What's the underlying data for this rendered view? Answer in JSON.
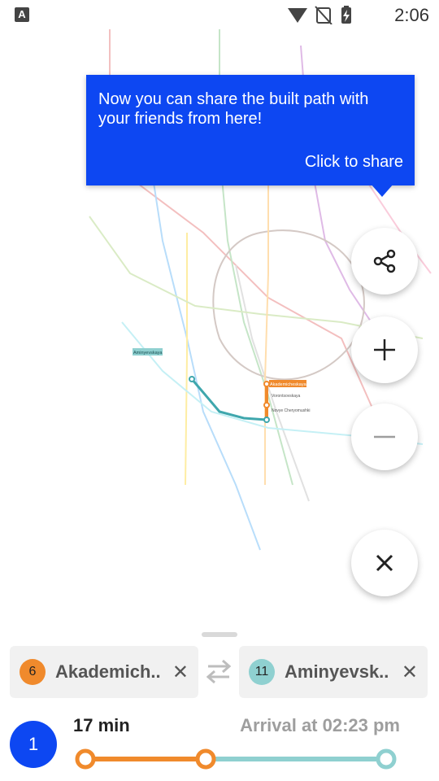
{
  "status_bar": {
    "app_icon_letter": "A",
    "time": "2:06"
  },
  "tooltip": {
    "message": "Now you can share the built path with your friends from here!",
    "action": "Click to share"
  },
  "map": {
    "labels": {
      "highlight_station": "Aminyevskaya",
      "route_station_1": "Akademicheskaya",
      "route_station_2": "Vorontsovskaya",
      "route_station_3": "Novye Cheryomushki"
    }
  },
  "fab": {
    "share_icon": "share-icon",
    "zoom_in_icon": "plus-icon",
    "zoom_out_icon": "minus-icon",
    "close_icon": "close-icon"
  },
  "route_form": {
    "from": {
      "line": "6",
      "name": "Akademich..",
      "color": "#f08a2c"
    },
    "to": {
      "line": "11",
      "name": "Aminyevsk..",
      "color": "#8fd0d0"
    },
    "clear_symbol": "✕"
  },
  "route_summary": {
    "index": "1",
    "duration": "17 min",
    "arrival": "Arrival at 02:23 pm",
    "progress_fraction": 0.4,
    "segment_colors": [
      "#f08a2c",
      "#8fd0d0"
    ]
  },
  "colors": {
    "accent": "#0d47f2"
  }
}
